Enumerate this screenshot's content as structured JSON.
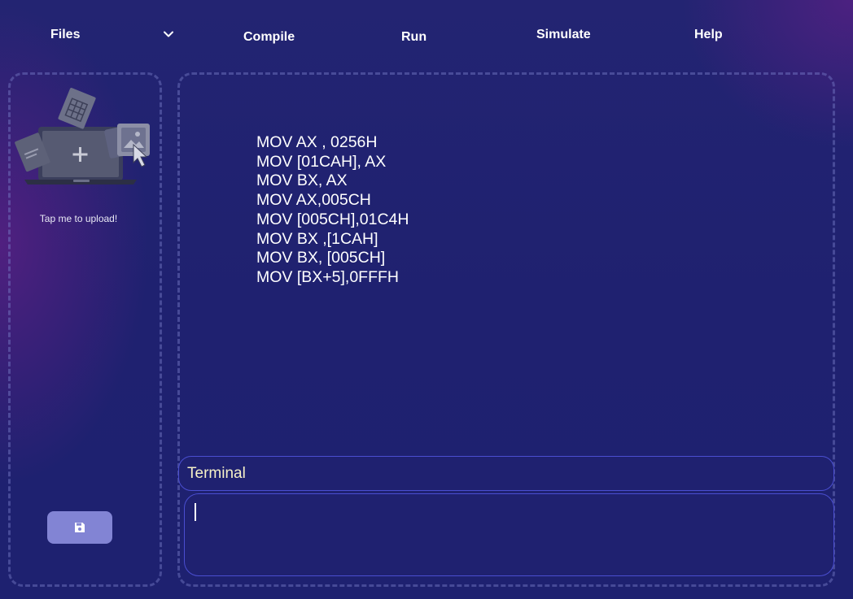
{
  "menu": {
    "files": "Files",
    "compile": "Compile",
    "run": "Run",
    "simulate": "Simulate",
    "help": "Help",
    "files_dropdown_icon": "chevron-down-icon"
  },
  "sidebar": {
    "upload_label": "Tap me to upload!",
    "upload_icon": "upload-laptop-illustration",
    "save_icon": "floppy-disk-icon",
    "colors": {
      "save_button": "#8284d4"
    }
  },
  "editor": {
    "lines": [
      "MOV AX , 0256H",
      "MOV [01CAH], AX",
      "MOV BX, AX",
      "MOV AX,005CH",
      "MOV [005CH],01C4H",
      "MOV BX ,[1CAH]",
      "MOV BX, [005CH]",
      "MOV [BX+5],0FFFH"
    ]
  },
  "terminal": {
    "title": "Terminal",
    "value": "",
    "colors": {
      "title": "#f6f1c7",
      "border": "#4a4ed0"
    }
  },
  "colors": {
    "background": "#1f2170",
    "panel_border": "#6e73c0"
  }
}
